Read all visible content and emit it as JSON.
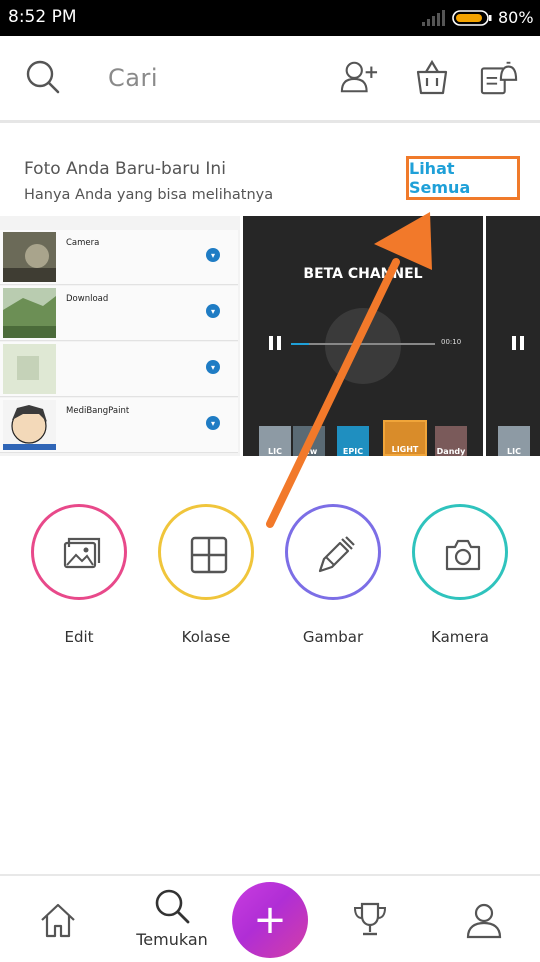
{
  "status_bar": {
    "time": "8:52 PM",
    "battery": "80%",
    "battery_color": "#f4a300"
  },
  "header": {
    "search_placeholder": "Cari"
  },
  "recent": {
    "title": "Foto Anda Baru-baru Ini",
    "subtitle": "Hanya Anda yang bisa melihatnya",
    "see_all": "Lihat Semua"
  },
  "thumbnails": {
    "folders": [
      {
        "name": "Camera"
      },
      {
        "name": "Download"
      },
      {
        "name": ""
      },
      {
        "name": "MediBangPaint"
      }
    ],
    "video_title": "BETA CHANNEL",
    "video_time": "00:10",
    "tiles": [
      "LIC",
      "...w",
      "EPIC",
      "LIGHT",
      "Dandy"
    ],
    "tiles_right": [
      "LIC"
    ]
  },
  "tools": [
    {
      "label": "Edit",
      "color": "#e8498a"
    },
    {
      "label": "Kolase",
      "color": "#f0c53b"
    },
    {
      "label": "Gambar",
      "color": "#7c6ee6"
    },
    {
      "label": "Kamera",
      "color": "#2fc3bd"
    }
  ],
  "nav": {
    "discover_label": "Temukan",
    "fab_label": "+",
    "accent": "#b832d8"
  },
  "annotation": {
    "arrow_color": "#f2792a"
  }
}
